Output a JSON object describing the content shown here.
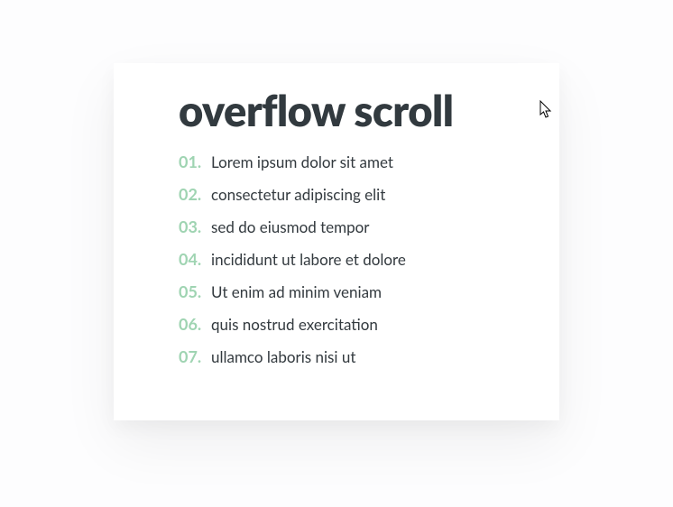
{
  "title": "overflow scroll",
  "accent_color": "#9fd4b2",
  "items": [
    {
      "num": "01.",
      "text": "Lorem ipsum dolor sit amet"
    },
    {
      "num": "02.",
      "text": "consectetur adipiscing elit"
    },
    {
      "num": "03.",
      "text": "sed do eiusmod tempor"
    },
    {
      "num": "04.",
      "text": "incididunt ut labore et dolore"
    },
    {
      "num": "05.",
      "text": "Ut enim ad minim veniam"
    },
    {
      "num": "06.",
      "text": "quis nostrud exercitation"
    },
    {
      "num": "07.",
      "text": "ullamco laboris nisi ut"
    }
  ]
}
